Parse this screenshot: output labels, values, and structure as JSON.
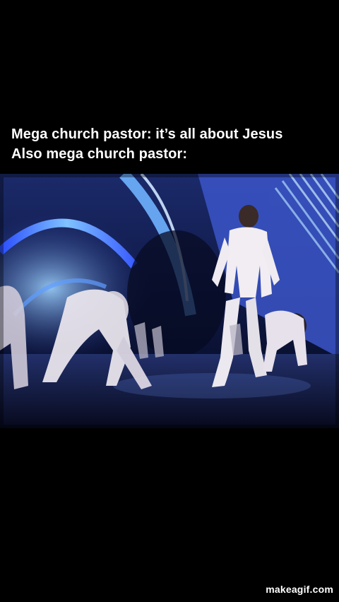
{
  "caption": {
    "line1": "Mega church pastor: it’s all about Jesus",
    "line2": "Also mega church pastor:"
  },
  "watermark": {
    "text": "makeagif.com"
  },
  "colors": {
    "background": "#000000",
    "caption_text": "#ffffff",
    "stage_light": "#5aa8ff",
    "stage_dark": "#0a0f2a"
  }
}
